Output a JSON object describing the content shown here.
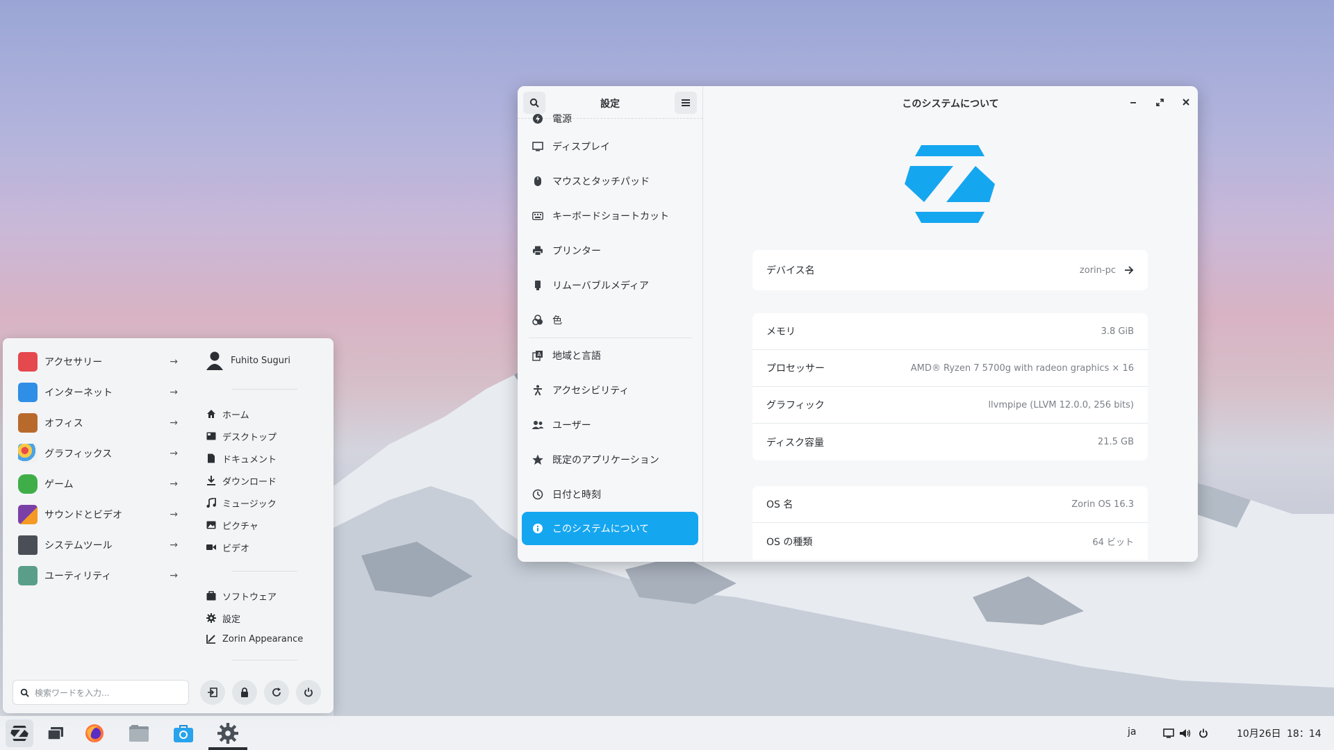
{
  "settings": {
    "sidebar_title": "設定",
    "window_title": "このシステムについて",
    "nav_items": [
      {
        "label": "電源",
        "icon": "power-icon"
      },
      {
        "label": "ディスプレイ",
        "icon": "display-icon"
      },
      {
        "label": "マウスとタッチパッド",
        "icon": "mouse-icon"
      },
      {
        "label": "キーボードショートカット",
        "icon": "keyboard-icon"
      },
      {
        "label": "プリンター",
        "icon": "printer-icon"
      },
      {
        "label": "リムーバブルメディア",
        "icon": "removable-media-icon"
      },
      {
        "label": "色",
        "icon": "color-icon"
      },
      {
        "label": "地域と言語",
        "icon": "region-language-icon"
      },
      {
        "label": "アクセシビリティ",
        "icon": "accessibility-icon"
      },
      {
        "label": "ユーザー",
        "icon": "users-icon"
      },
      {
        "label": "既定のアプリケーション",
        "icon": "star-icon"
      },
      {
        "label": "日付と時刻",
        "icon": "clock-icon"
      },
      {
        "label": "このシステムについて",
        "icon": "info-icon",
        "active": true
      }
    ],
    "device": {
      "label": "デバイス名",
      "value": "zorin-pc"
    },
    "hardware": [
      {
        "label": "メモリ",
        "value": "3.8 GiB"
      },
      {
        "label": "プロセッサー",
        "value": "AMD® Ryzen 7 5700g with radeon graphics × 16"
      },
      {
        "label": "グラフィック",
        "value": "llvmpipe (LLVM 12.0.0, 256 bits)"
      },
      {
        "label": "ディスク容量",
        "value": "21.5 GB"
      }
    ],
    "os": [
      {
        "label": "OS 名",
        "value": "Zorin OS 16.3"
      },
      {
        "label": "OS の種類",
        "value": "64 ビット"
      }
    ],
    "accent_color": "#15a6f0"
  },
  "menu": {
    "categories": [
      {
        "label": "アクセサリー",
        "color": "#e5484d"
      },
      {
        "label": "インターネット",
        "color": "#2f8ee6"
      },
      {
        "label": "オフィス",
        "color": "#b86a2c"
      },
      {
        "label": "グラフィックス",
        "color": "#f1f1f1"
      },
      {
        "label": "ゲーム",
        "color": "#3fae49"
      },
      {
        "label": "サウンドとビデオ",
        "color": "#7b3fa8"
      },
      {
        "label": "システムツール",
        "color": "#4a4f57"
      },
      {
        "label": "ユーティリティ",
        "color": "#5a9e8a"
      }
    ],
    "arrow": "→",
    "user_name": "Fuhito Suguri",
    "places": [
      {
        "label": "ホーム",
        "icon": "home-icon"
      },
      {
        "label": "デスクトップ",
        "icon": "desktop-icon"
      },
      {
        "label": "ドキュメント",
        "icon": "document-icon"
      },
      {
        "label": "ダウンロード",
        "icon": "download-icon"
      },
      {
        "label": "ミュージック",
        "icon": "music-icon"
      },
      {
        "label": "ピクチャ",
        "icon": "picture-icon"
      },
      {
        "label": "ビデオ",
        "icon": "video-icon"
      }
    ],
    "apps": [
      {
        "label": "ソフトウェア",
        "icon": "software-icon"
      },
      {
        "label": "設定",
        "icon": "gear-icon"
      },
      {
        "label": "Zorin Appearance",
        "icon": "appearance-icon"
      }
    ],
    "search_placeholder": "検索ワードを入力..."
  },
  "taskbar": {
    "lang": "ja",
    "date": "10月26日",
    "time": "18：14"
  }
}
